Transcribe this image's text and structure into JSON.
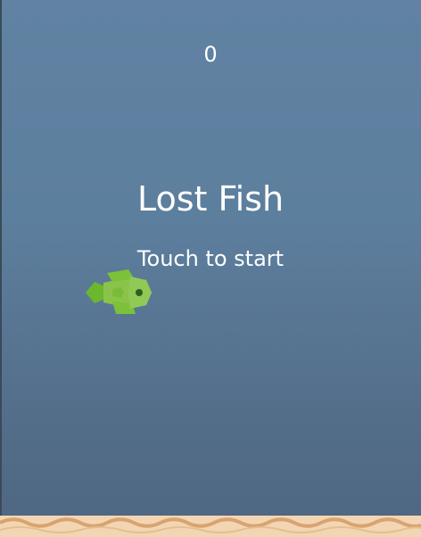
{
  "hud": {
    "score": "0"
  },
  "menu": {
    "title": "Lost Fish",
    "prompt": "Touch to start"
  },
  "colors": {
    "sky_top": "#6182a2",
    "sky_bottom": "#4e6681",
    "fish_body": "#8bc34a",
    "fish_fin": "#6bb82f",
    "fish_eye": "#2f5f1e",
    "sand": "#f2d6b3",
    "sand_line": "#d9a36f"
  },
  "icons": {
    "player": "fish-icon"
  }
}
